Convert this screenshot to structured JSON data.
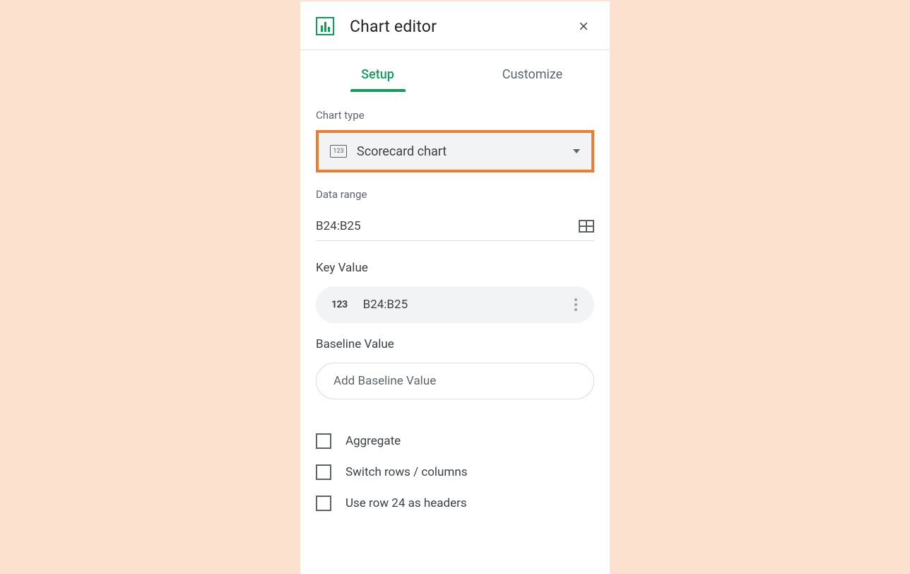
{
  "header": {
    "title": "Chart editor"
  },
  "tabs": {
    "setup": "Setup",
    "customize": "Customize"
  },
  "chartType": {
    "label": "Chart type",
    "iconText": "123",
    "value": "Scorecard chart"
  },
  "dataRange": {
    "label": "Data range",
    "value": "B24:B25"
  },
  "keyValue": {
    "label": "Key Value",
    "iconText": "123",
    "value": "B24:B25"
  },
  "baselineValue": {
    "label": "Baseline Value",
    "placeholder": "Add Baseline Value"
  },
  "checkboxes": {
    "aggregate": "Aggregate",
    "switchRows": "Switch rows / columns",
    "useRowHeaders": "Use row 24 as headers"
  }
}
